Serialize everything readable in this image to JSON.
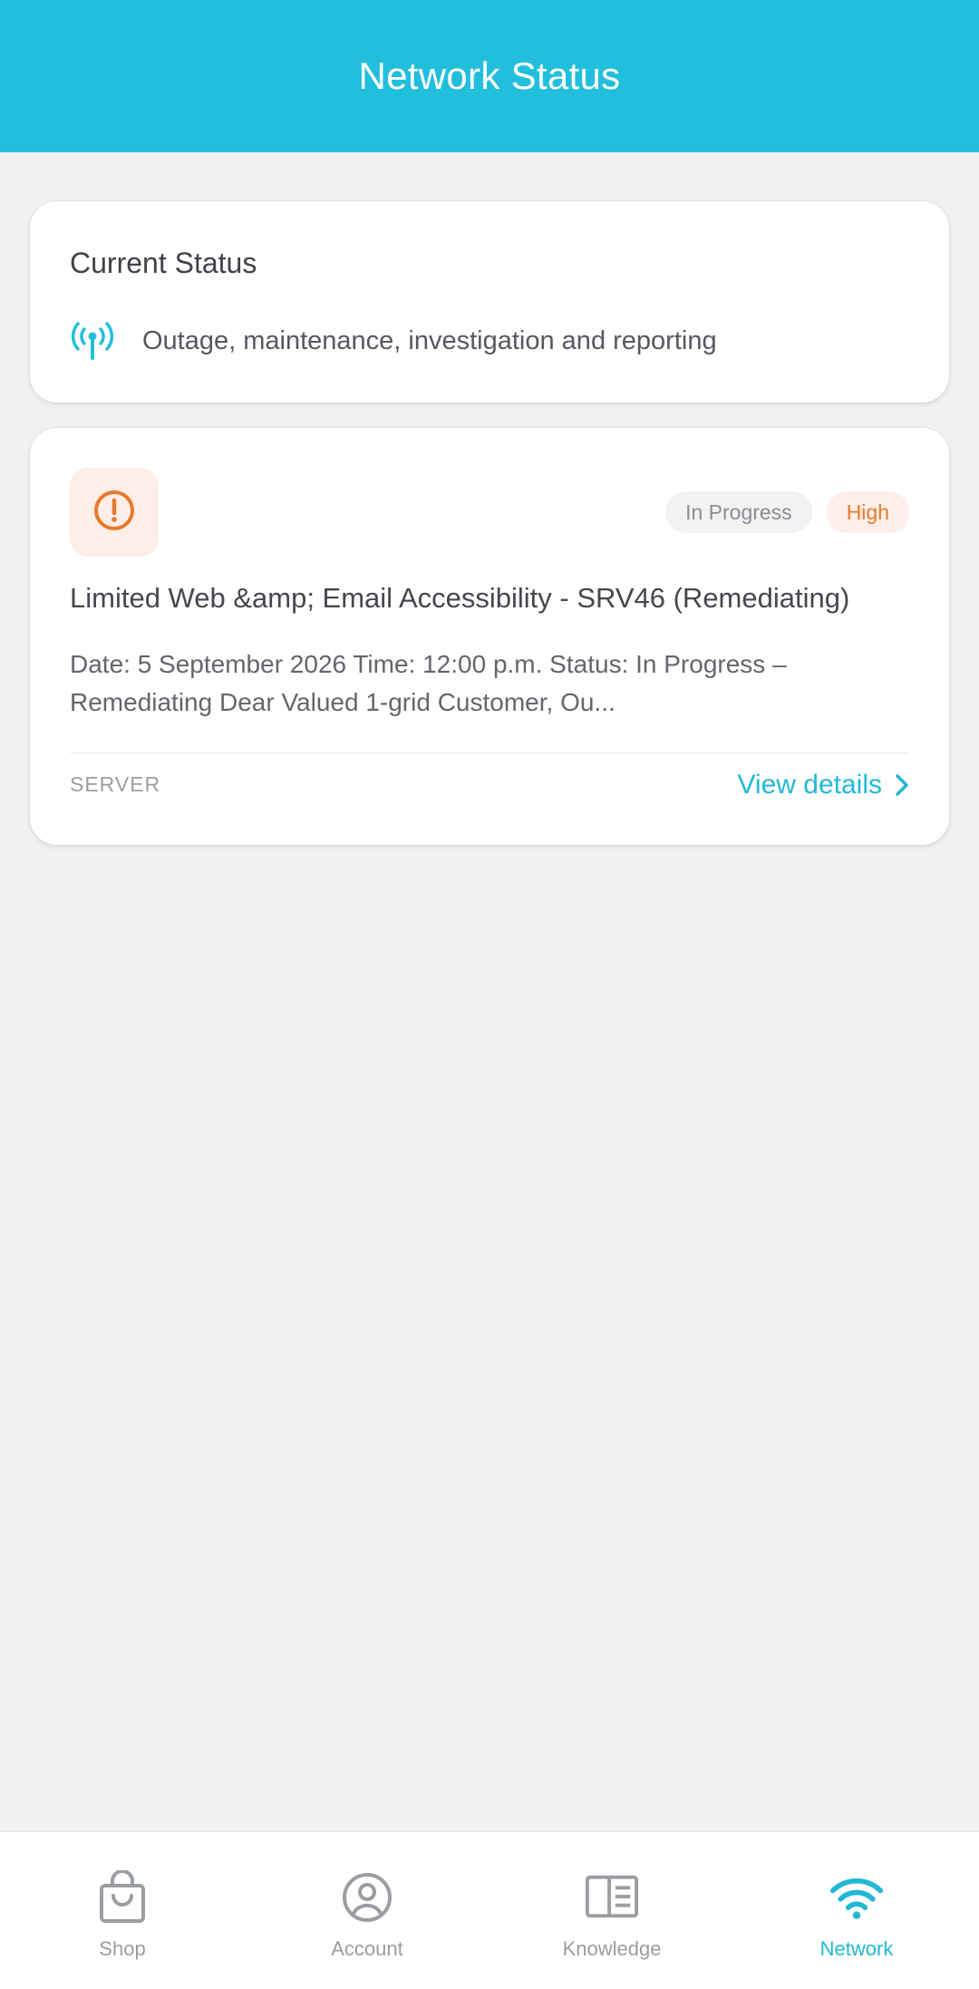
{
  "header": {
    "title": "Network Status"
  },
  "current_status": {
    "heading": "Current Status",
    "description": "Outage, maintenance, investigation and reporting",
    "icon": "antenna-signal-icon"
  },
  "incident": {
    "icon": "alert-circle-icon",
    "status_badge": "In Progress",
    "priority_badge": "High",
    "title": "Limited Web &amp; Email Accessibility - SRV46 (Remediating)",
    "summary": "Date:  5 September 2026  Time:  12:00 p.m.    Status:   In Progress – Remediating     Dear Valued 1-grid Customer,    Ou...",
    "category": "SERVER",
    "view_details_label": "View details"
  },
  "bottom_nav": {
    "items": [
      {
        "label": "Shop",
        "icon": "shopping-bag-icon",
        "active": false
      },
      {
        "label": "Account",
        "icon": "user-circle-icon",
        "active": false
      },
      {
        "label": "Knowledge",
        "icon": "book-open-icon",
        "active": false
      },
      {
        "label": "Network",
        "icon": "wifi-icon",
        "active": true
      }
    ]
  },
  "colors": {
    "accent": "#22bfdd",
    "warning": "#e57a2c",
    "background": "#f1f1f2"
  }
}
